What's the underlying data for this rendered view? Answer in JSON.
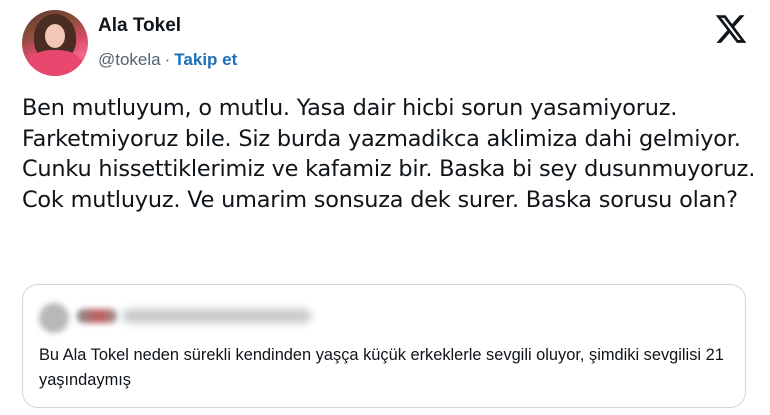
{
  "author": {
    "name": "Ala Tokel",
    "handle": "@tokela",
    "separator": "·",
    "follow_label": "Takip et"
  },
  "brand": {
    "logo_icon": "x-logo-icon"
  },
  "tweet": {
    "text": "Ben mutluyum, o mutlu. Yasa dair hicbi sorun yasamiyoruz. Farketmiyoruz bile. Siz burda yazmadikca aklimiza dahi gelmiyor. Cunku hissettiklerimiz ve kafamiz bir. Baska bi sey dusunmuyoruz. Cok mutluyuz. Ve umarim sonsuza dek surer. Baska sorusu olan?"
  },
  "quoted_tweet": {
    "text": "Bu Ala Tokel neden sürekli kendinden yaşça küçük erkeklerle sevgili oluyor, şimdiki sevgilisi 21 yaşındaymış"
  },
  "colors": {
    "follow": "#1d6fb8",
    "secondary_text": "#536471",
    "border": "#cfd9de"
  }
}
